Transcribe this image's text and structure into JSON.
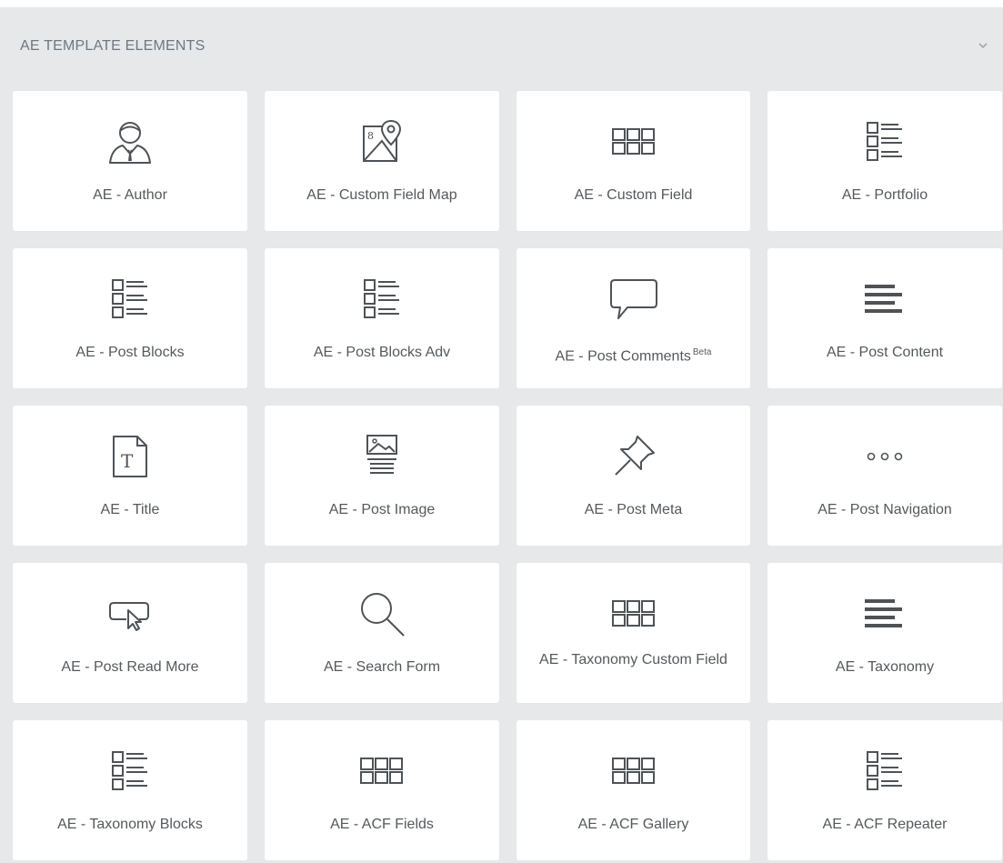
{
  "section": {
    "title": "AE TEMPLATE ELEMENTS",
    "chevron_icon": "chevron-down-icon"
  },
  "widgets": [
    {
      "label": "AE - Author",
      "icon": "person-icon"
    },
    {
      "label": "AE - Custom Field Map",
      "icon": "map-pin-icon"
    },
    {
      "label": "AE - Custom Field",
      "icon": "grid-icon"
    },
    {
      "label": "AE - Portfolio",
      "icon": "list-icon"
    },
    {
      "label": "AE - Post Blocks",
      "icon": "list-icon"
    },
    {
      "label": "AE - Post Blocks Adv",
      "icon": "list-icon"
    },
    {
      "label": "AE - Post Comments",
      "badge": "Beta",
      "icon": "comment-icon"
    },
    {
      "label": "AE - Post Content",
      "icon": "align-left-icon"
    },
    {
      "label": "AE - Title",
      "icon": "title-document-icon"
    },
    {
      "label": "AE - Post Image",
      "icon": "image-text-icon"
    },
    {
      "label": "AE - Post Meta",
      "icon": "pushpin-icon"
    },
    {
      "label": "AE - Post Navigation",
      "icon": "ellipsis-icon"
    },
    {
      "label": "AE - Post Read More",
      "icon": "button-cursor-icon"
    },
    {
      "label": "AE - Search Form",
      "icon": "search-icon"
    },
    {
      "label": "AE - Taxonomy Custom Field",
      "icon": "grid-icon"
    },
    {
      "label": "AE - Taxonomy",
      "icon": "align-left-icon"
    },
    {
      "label": "AE - Taxonomy Blocks",
      "icon": "list-icon"
    },
    {
      "label": "AE - ACF Fields",
      "icon": "grid-icon"
    },
    {
      "label": "AE - ACF Gallery",
      "icon": "grid-icon"
    },
    {
      "label": "AE - ACF Repeater",
      "icon": "list-icon"
    }
  ]
}
